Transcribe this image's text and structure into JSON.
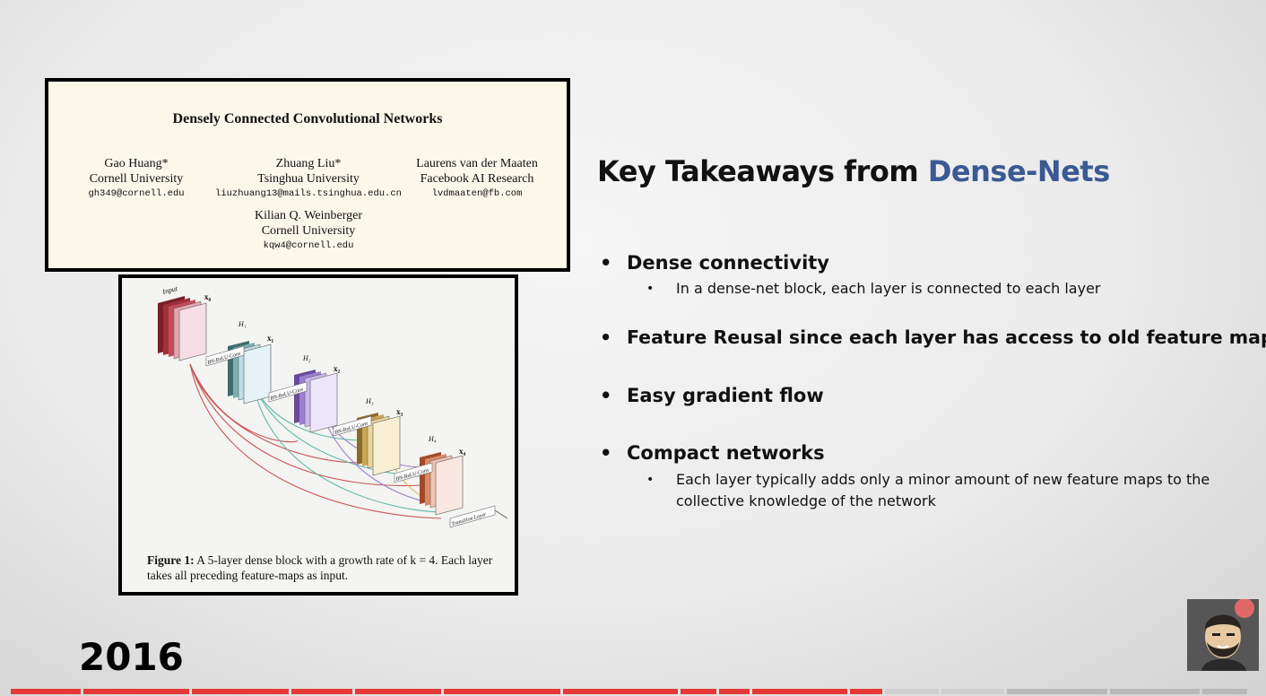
{
  "slide": {
    "heading_prefix": "Key Takeaways from ",
    "heading_accent": "Dense-Nets",
    "year": "2016",
    "colors": {
      "accent": "#3a5a94",
      "progress_played": "#e53935",
      "progress_buffered": "#cfcfcf"
    }
  },
  "paper": {
    "title": "Densely Connected Convolutional Networks",
    "authors": [
      {
        "name": "Gao Huang*",
        "affiliation": "Cornell University",
        "email": "gh349@cornell.edu"
      },
      {
        "name": "Zhuang Liu*",
        "affiliation": "Tsinghua University",
        "email": "liuzhuang13@mails.tsinghua.edu.cn"
      },
      {
        "name": "Laurens van der Maaten",
        "affiliation": "Facebook AI Research",
        "email": "lvdmaaten@fb.com"
      },
      {
        "name": "Kilian Q. Weinberger",
        "affiliation": "Cornell University",
        "email": "kqw4@cornell.edu"
      }
    ]
  },
  "figure": {
    "input_label": "Input",
    "x_labels": [
      "x₀",
      "x₁",
      "x₂",
      "x₃",
      "x₄"
    ],
    "h_labels": [
      "H₁",
      "H₂",
      "H₃",
      "H₄"
    ],
    "conv_label": "BN-ReLU-Conv",
    "transition_label": "Transition Layer",
    "caption_bold": "Figure 1:",
    "caption_text": "A 5-layer dense block with a growth rate of k = 4. Each layer takes all preceding feature-maps as input."
  },
  "bullets": [
    {
      "label": "Dense connectivity",
      "sub": "In a dense-net block, each layer is connected to each layer"
    },
    {
      "label": "Feature Reusal since each layer has access to old feature maps",
      "sub": ""
    },
    {
      "label": "Easy gradient flow",
      "sub": ""
    },
    {
      "label": "Compact networks",
      "sub": "Each layer typically adds only a minor amount of new feature maps to the collective knowledge of the network"
    }
  ],
  "bullet_glyph": "•"
}
